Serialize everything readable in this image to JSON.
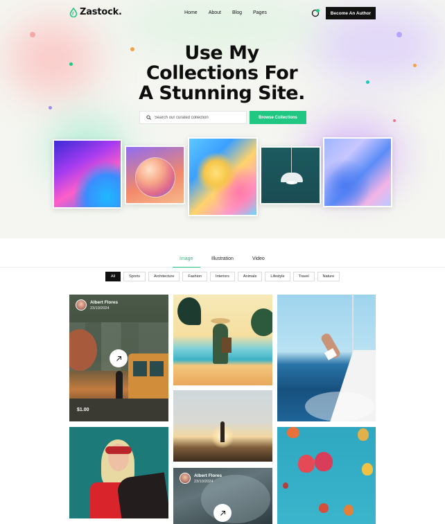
{
  "brand": {
    "name": "Zastock.",
    "accent": "#1fc783"
  },
  "nav": {
    "items": [
      "Home",
      "About",
      "Blog",
      "Pages"
    ],
    "cart_icon": "cart-icon",
    "cta": "Become An Author"
  },
  "hero": {
    "title_lines": [
      "Use My",
      "Collections For",
      "A Stunning Site."
    ],
    "search_placeholder": "Search our curated collection",
    "browse_label": "Browse Collections"
  },
  "tabs": {
    "items": [
      "Image",
      "Illustration",
      "Video"
    ],
    "active": "Image"
  },
  "filters": {
    "items": [
      "All",
      "Sports",
      "Architecture",
      "Fashion",
      "Interiors",
      "Animals",
      "Lifestyle",
      "Travel",
      "Nature"
    ],
    "active": "All"
  },
  "cards": [
    {
      "author": "Albert Flores",
      "date": "23/10/2024",
      "price": "$1.00"
    },
    {
      "author": "Albert Flores",
      "date": "23/10/2024"
    }
  ]
}
